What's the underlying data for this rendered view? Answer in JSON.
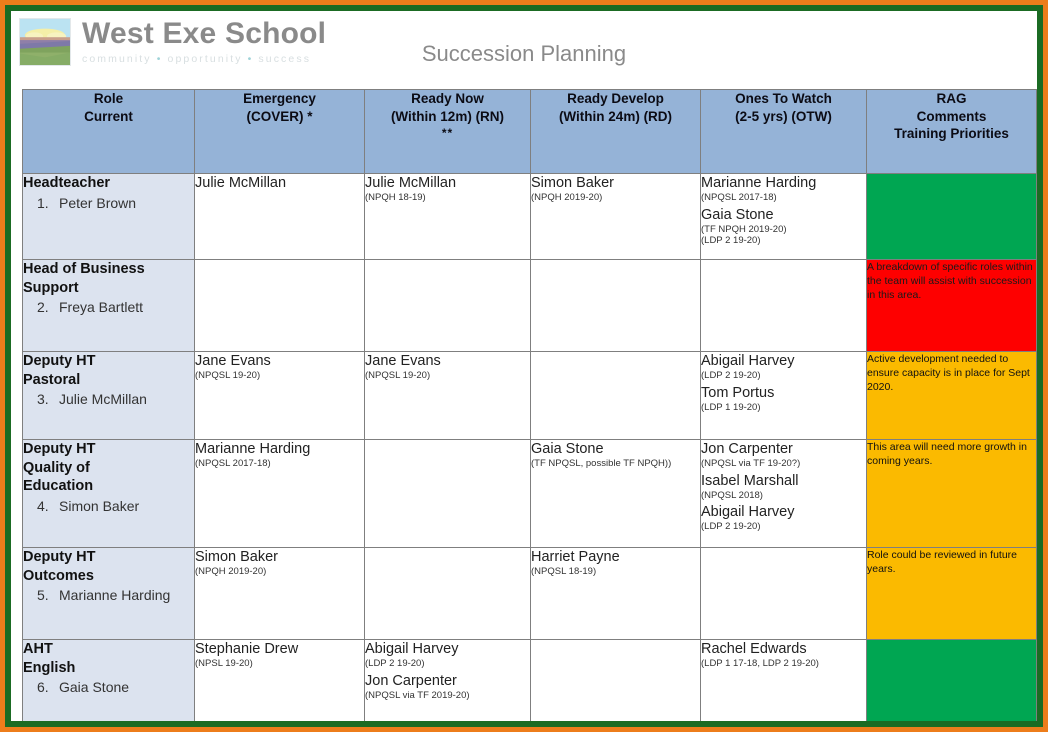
{
  "document": {
    "school_name": "West Exe School",
    "tagline_words": [
      "community",
      "opportunity",
      "success"
    ],
    "tagline_separator": "•",
    "title": "Succession Planning",
    "logo_icon": "landscape-logo-icon"
  },
  "colors": {
    "border_outer": "#ED7D1B",
    "border_inner": "#1B6B23",
    "header_blue": "#95B3D7",
    "role_blue": "#DCE3EF",
    "rag_green": "#00A652",
    "rag_red": "#FE0000",
    "rag_amber": "#FBBA00",
    "grid_line": "#7F7F7F",
    "brand_gray": "#8A8A8A"
  },
  "table": {
    "columns": [
      {
        "key": "role",
        "line1": "Role",
        "line2": "Current",
        "line3": ""
      },
      {
        "key": "emergency",
        "line1": "Emergency",
        "line2": "(COVER) *",
        "line3": ""
      },
      {
        "key": "ready_now",
        "line1": "Ready Now",
        "line2": "(Within 12m) (RN)",
        "line3": "**"
      },
      {
        "key": "ready_dev",
        "line1": "Ready Develop",
        "line2": "(Within 24m) (RD)",
        "line3": ""
      },
      {
        "key": "otw",
        "line1": "Ones To Watch",
        "line2": "(2-5 yrs) (OTW)",
        "line3": ""
      },
      {
        "key": "rag",
        "line1": "RAG",
        "line2": "Comments",
        "line3": "Training Priorities"
      }
    ],
    "rows": [
      {
        "role": {
          "title_lines": [
            "Headteacher"
          ],
          "number": "1.",
          "person": "Peter Brown"
        },
        "emergency": [
          {
            "name": "Julie McMillan",
            "qual": ""
          }
        ],
        "ready_now": [
          {
            "name": "Julie McMillan",
            "qual": "(NPQH 18-19)"
          }
        ],
        "ready_dev": [
          {
            "name": "Simon Baker",
            "qual": "(NPQH 2019-20)"
          }
        ],
        "otw": [
          {
            "name": "Marianne Harding",
            "qual": "(NPQSL 2017-18)"
          },
          {
            "name": "Gaia Stone",
            "qual": "(TF NPQH 2019-20)",
            "qual2": " (LDP 2 19-20)"
          }
        ],
        "rag": {
          "status": "green",
          "comment": ""
        }
      },
      {
        "role": {
          "title_lines": [
            "Head of Business",
            "Support"
          ],
          "number": "2.",
          "person": "Freya Bartlett"
        },
        "emergency": [],
        "ready_now": [],
        "ready_dev": [],
        "otw": [],
        "rag": {
          "status": "red",
          "comment": "A breakdown of specific roles within the team will assist with succession in this area."
        }
      },
      {
        "role": {
          "title_lines": [
            "Deputy HT",
            "Pastoral"
          ],
          "number": "3.",
          "person": "Julie McMillan"
        },
        "emergency": [
          {
            "name": "Jane Evans",
            "qual": "(NPQSL 19-20)"
          }
        ],
        "ready_now": [
          {
            "name": "Jane Evans",
            "qual": "(NPQSL 19-20)"
          }
        ],
        "ready_dev": [],
        "otw": [
          {
            "name": "Abigail Harvey",
            "qual": "(LDP 2 19-20)"
          },
          {
            "name": "Tom Portus",
            "qual": "(LDP 1 19-20)"
          }
        ],
        "rag": {
          "status": "amber",
          "comment": "Active development needed to ensure capacity is in place for Sept 2020."
        }
      },
      {
        "role": {
          "title_lines": [
            "Deputy HT",
            "Quality of",
            "Education"
          ],
          "number": "4.",
          "person": "Simon Baker"
        },
        "emergency": [
          {
            "name": "Marianne Harding",
            "qual": "(NPQSL 2017-18)"
          }
        ],
        "ready_now": [],
        "ready_dev": [
          {
            "name": "Gaia Stone",
            "qual": "(TF NPQSL, possible TF NPQH))",
            "center": true
          }
        ],
        "otw": [
          {
            "name": "Jon Carpenter",
            "qual": "(NPQSL via TF 19-20?)"
          },
          {
            "name": "Isabel Marshall",
            "qual": "(NPQSL 2018)"
          },
          {
            "name": "Abigail Harvey",
            "qual": "(LDP 2 19-20)"
          }
        ],
        "rag": {
          "status": "amber",
          "comment": "This area will need more growth in coming years."
        }
      },
      {
        "role": {
          "title_lines": [
            "Deputy HT",
            "Outcomes"
          ],
          "number": "5.",
          "person": "Marianne Harding"
        },
        "emergency": [
          {
            "name": "Simon Baker",
            "qual": "(NPQH 2019-20)"
          }
        ],
        "ready_now": [],
        "ready_dev": [
          {
            "name": "Harriet Payne",
            "qual": "(NPQSL 18-19)"
          }
        ],
        "otw": [],
        "rag": {
          "status": "amber",
          "comment": "Role could be reviewed in future years."
        }
      },
      {
        "role": {
          "title_lines": [
            "AHT",
            "English"
          ],
          "number": "6.",
          "person": "Gaia Stone"
        },
        "emergency": [
          {
            "name": "Stephanie Drew",
            "qual": "(NPSL 19-20)"
          }
        ],
        "ready_now": [
          {
            "name": "Abigail Harvey",
            "qual": "(LDP 2 19-20)"
          },
          {
            "name": "Jon Carpenter",
            "qual": "(NPQSL via TF 2019-20)"
          }
        ],
        "ready_dev": [],
        "otw": [
          {
            "name": "Rachel Edwards",
            "qual": "(LDP 1 17-18, LDP 2 19-20)"
          }
        ],
        "rag": {
          "status": "green",
          "comment": ""
        }
      }
    ]
  }
}
